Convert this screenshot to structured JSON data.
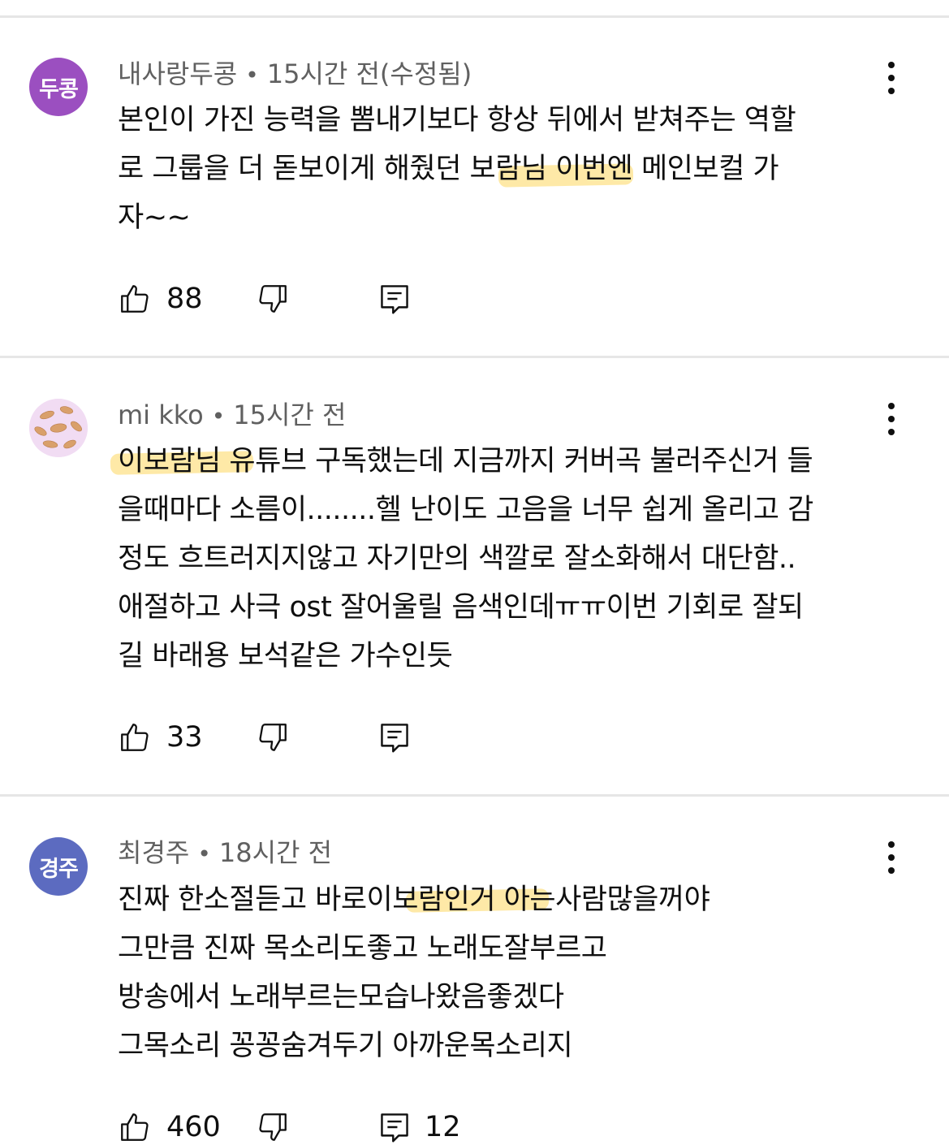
{
  "comments": [
    {
      "avatar_text": "두콩",
      "avatar_color": "#9b4fc0",
      "author": "내사랑두콩",
      "time": "15시간 전(수정됨)",
      "lines": [
        "본인이 가진 능력을 뽐내기보다  항상 뒤에서 받쳐주는 역할",
        "로 그룹을 더 돋보이게 해줬던 보람님  이번엔  메인보컬 가",
        "자~~"
      ],
      "likes": "88",
      "replies": ""
    },
    {
      "avatar_text": "",
      "avatar_color": "#f3e3f6",
      "author": "mi kko",
      "time": "15시간 전",
      "lines": [
        "이보람님 유튜브 구독했는데 지금까지 커버곡 불러주신거 들",
        "을때마다 소름이........헬 난이도 고음을 너무 쉽게 올리고 감",
        "정도 흐트러지지않고 자기만의 색깔로 잘소화해서 대단함..",
        "애절하고 사극 ost 잘어울릴 음색인데ㅠㅠ이번 기회로 잘되",
        "길 바래용 보석같은 가수인듯"
      ],
      "likes": "33",
      "replies": ""
    },
    {
      "avatar_text": "경주",
      "avatar_color": "#5c6bc0",
      "author": "최경주",
      "time": "18시간 전",
      "lines": [
        "진짜 한소절듣고 바로이보람인거 아는사람많을꺼야",
        "그만큼 진짜 목소리도좋고 노래도잘부르고",
        "방송에서 노래부르는모습나왔음좋겠다",
        "그목소리 꽁꽁숨겨두기 아까운목소리지"
      ],
      "likes": "460",
      "replies": "12"
    }
  ],
  "highlight_color": "#fdd75f",
  "icons": {
    "like": "thumbs-up-icon",
    "dislike": "thumbs-down-icon",
    "reply": "comment-reply-icon",
    "more": "more-vertical-icon"
  }
}
